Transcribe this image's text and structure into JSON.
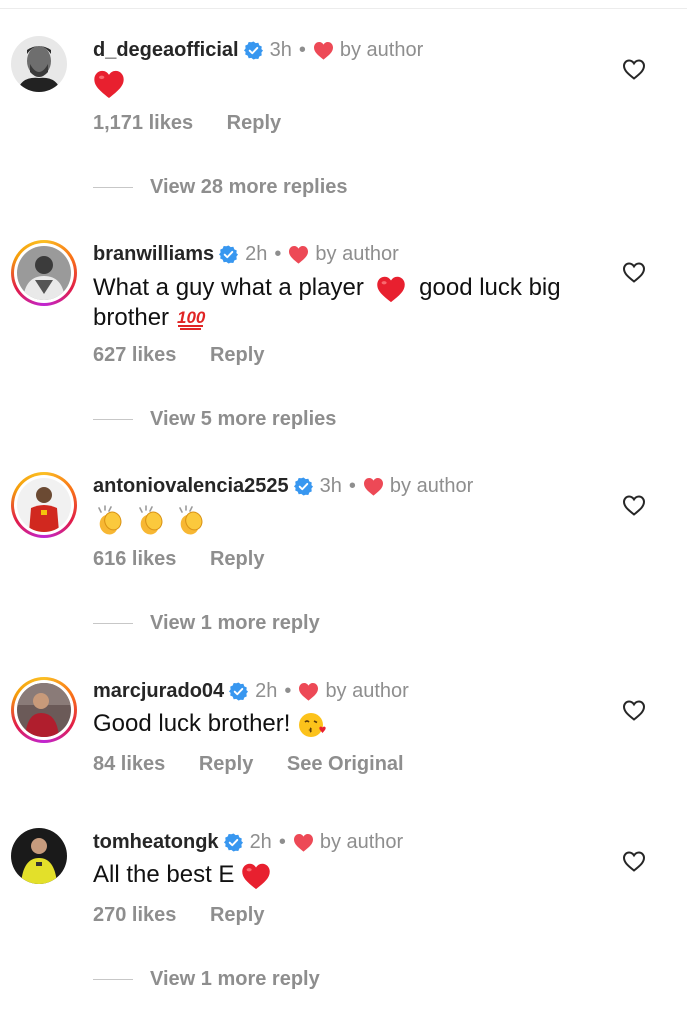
{
  "comments": [
    {
      "username": "d_degeaofficial",
      "time": "3h",
      "liked_by": "by author",
      "text": "",
      "text_emoji": "red-heart",
      "likes": "1,171 likes",
      "reply": "Reply",
      "view_replies": "View 28 more replies"
    },
    {
      "username": "branwilliams",
      "time": "2h",
      "liked_by": "by author",
      "text_a": "What a guy what a player",
      "text_b": " good luck big brother ",
      "text_emoji": "red-heart, hundred-points",
      "likes": "627 likes",
      "reply": "Reply",
      "view_replies": "View 5 more replies"
    },
    {
      "username": "antoniovalencia2525",
      "time": "3h",
      "liked_by": "by author",
      "text_emoji": "clapping-hands x3",
      "likes": "616 likes",
      "reply": "Reply",
      "view_replies": "View 1 more reply"
    },
    {
      "username": "marcjurado04",
      "time": "2h",
      "liked_by": "by author",
      "text": "Good luck brother! ",
      "text_emoji": "face-blowing-kiss",
      "likes": "84 likes",
      "reply": "Reply",
      "see_original": "See Original"
    },
    {
      "username": "tomheatongk",
      "time": "2h",
      "liked_by": "by author",
      "text": "All the best E ",
      "text_emoji": "red-heart",
      "likes": "270 likes",
      "reply": "Reply",
      "view_replies": "View 1 more reply"
    }
  ],
  "colors": {
    "username": "#262626",
    "secondary": "#8e8e8e",
    "verified": "#3897f0",
    "heart": "#ed4956"
  },
  "icons": {
    "verified": "verified-badge-icon",
    "author_like": "red-heart-icon",
    "like_button": "heart-outline-icon"
  }
}
